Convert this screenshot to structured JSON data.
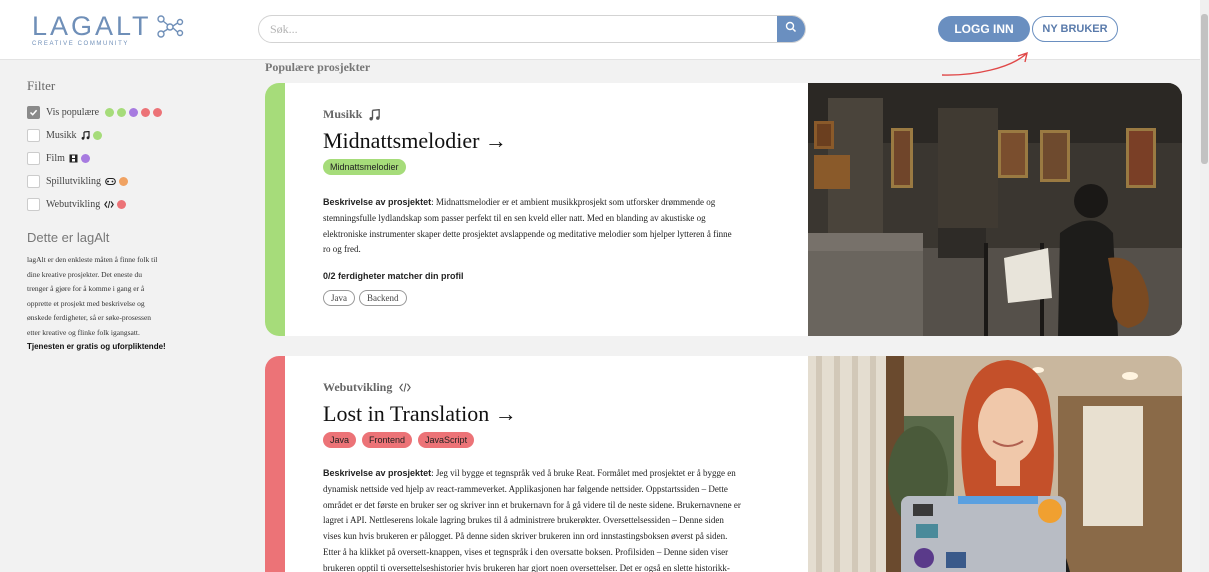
{
  "header": {
    "logo_text": "LAGALT",
    "logo_subtitle": "CREATIVE COMMUNITY",
    "search_placeholder": "Søk...",
    "login_label": "LOGG INN",
    "register_label": "NY BRUKER"
  },
  "sidebar": {
    "filter_title": "Filter",
    "filters": [
      {
        "label": "Vis populære",
        "checked": true,
        "dots": [
          "#a6dc7a",
          "#a6dc7a",
          "#a77be0",
          "#ec7377",
          "#ec7377"
        ]
      },
      {
        "label": "Musikk",
        "icon": "music-note-icon",
        "checked": false,
        "dots": [
          "#a6dc7a"
        ]
      },
      {
        "label": "Film",
        "icon": "film-icon",
        "checked": false,
        "dots": [
          "#a77be0"
        ]
      },
      {
        "label": "Spillutvikling",
        "icon": "gamepad-icon",
        "checked": false,
        "dots": [
          "#f0a262"
        ]
      },
      {
        "label": "Webutvikling",
        "icon": "code-icon",
        "checked": false,
        "dots": [
          "#ec7377"
        ]
      }
    ],
    "about_title": "Dette er lagAlt",
    "about_lines": [
      "lagAlt er den enkleste måten å finne folk til",
      "dine kreative prosjekter. Det eneste du",
      "trenger å gjøre for å komme i gang er å",
      "opprette et prosjekt med beskrivelse og",
      "ønskede ferdigheter, så er søke-prosessen",
      "etter kreative og flinke folk igangsatt."
    ],
    "about_strong": "Tjenesten er gratis og uforpliktende!"
  },
  "main": {
    "section_title": "Populære prosjekter",
    "projects": [
      {
        "category": "Musikk",
        "category_icon": "music-note-icon",
        "title": "Midnattsmelodier →",
        "accent": "#a6dc7a",
        "tags": [
          "Midnattsmelodier"
        ],
        "desc_label": "Beskrivelse av prosjektet",
        "desc_lines": [
          ": Midnattsmelodier er et ambient musikkprosjekt som utforsker drømmende og",
          "stemningsfulle lydlandskap som passer perfekt til en sen kveld eller natt. Med en blanding av akustiske og",
          "elektroniske instrumenter skaper dette prosjektet avslappende og meditative melodier som hjelper lytteren å finne",
          "ro og fred."
        ],
        "match_text": "0/2 ferdigheter matcher din profil",
        "skills": [
          "Java",
          "Backend"
        ]
      },
      {
        "category": "Webutvikling",
        "category_icon": "code-icon",
        "title": "Lost in Translation →",
        "accent": "#ec7377",
        "tags": [
          "Java",
          "Frontend",
          "JavaScript"
        ],
        "desc_label": "Beskrivelse av prosjektet",
        "desc_lines": [
          ": Jeg vil bygge et tegnspråk ved å bruke Reat. Formålet med prosjektet er å bygge en",
          "dynamisk nettside ved hjelp av react-rammeverket. Applikasjonen har følgende nettsider. Oppstartssiden – Dette",
          "området er det første en bruker ser og skriver inn et brukernavn for å gå videre til de neste sidene. Brukernavnene er",
          "lagret i API. Nettleserens lokale lagring brukes til å administrere brukerøkter. Oversettelsessiden – Denne siden",
          "vises kun hvis brukeren er pålogget. På denne siden skriver brukeren inn ord innstastingsboksen øverst på siden.",
          "Etter å ha klikket på oversett-knappen, vises et tegnspråk i den oversatte boksen. Profilsiden – Denne siden viser",
          "brukeren opptil ti oversettelseshistorier hvis brukeren har gjort noen oversettelser. Det er også en slette historikk-"
        ]
      }
    ]
  }
}
